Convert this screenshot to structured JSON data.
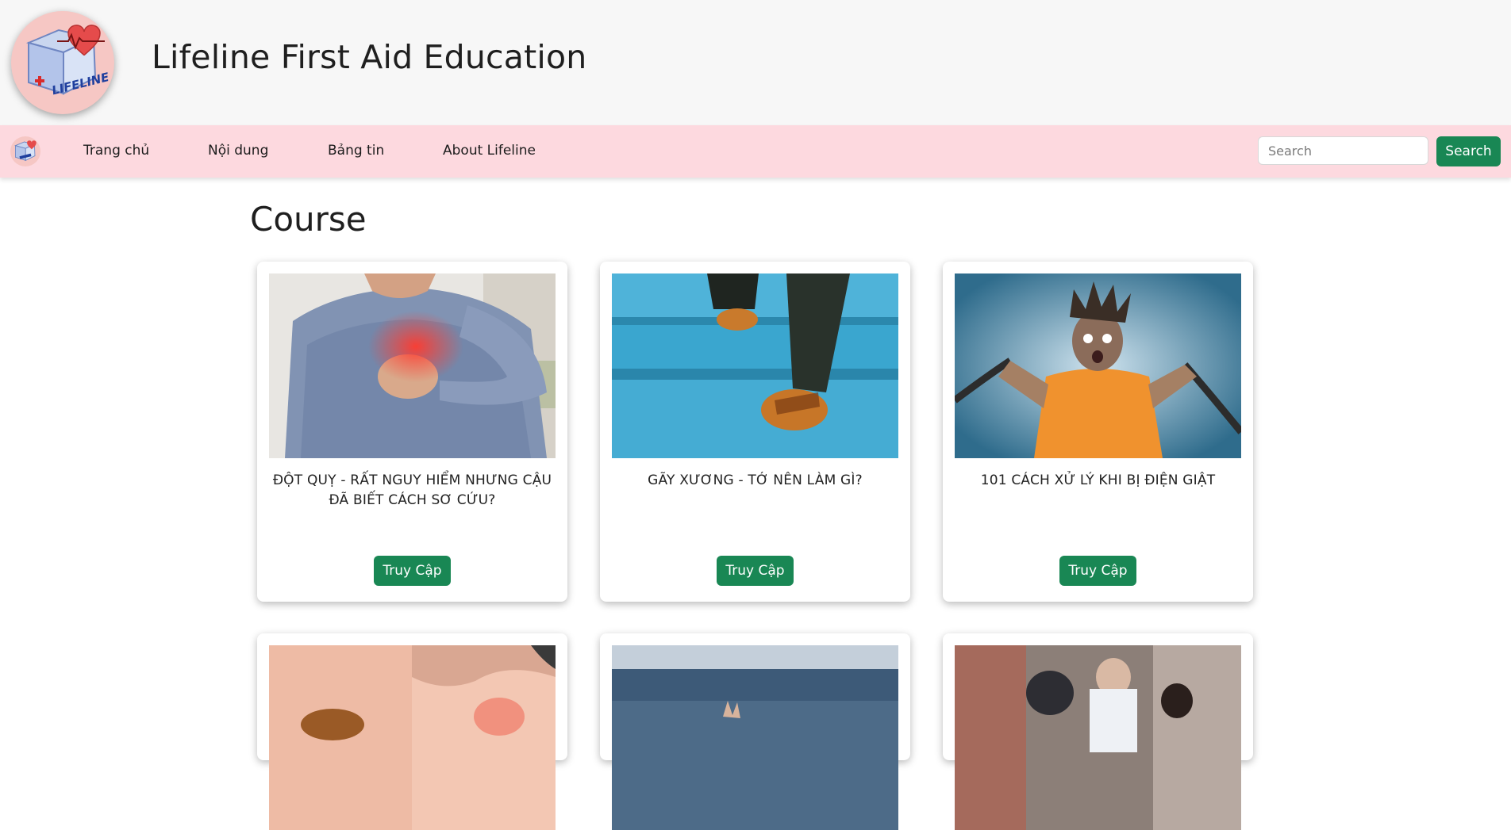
{
  "header": {
    "title": "Lifeline First Aid Education",
    "logo_text": "LIFELINE"
  },
  "nav": {
    "items": [
      {
        "label": "Trang chủ"
      },
      {
        "label": "Nội dung"
      },
      {
        "label": "Bảng tin"
      },
      {
        "label": "About Lifeline"
      }
    ],
    "search": {
      "placeholder": "Search",
      "value": "",
      "button_label": "Search"
    }
  },
  "main": {
    "section_title": "Course",
    "cards": [
      {
        "title": "ĐỘT QUỴ - RẤT NGUY HIỂM NHƯNG CẬU ĐÃ BIẾT CÁCH SƠ CỨU?",
        "button_label": "Truy Cập",
        "image_icon": "chest-pain-photo"
      },
      {
        "title": "GÃY XƯƠNG - TỚ NÊN LÀM GÌ?",
        "button_label": "Truy Cập",
        "image_icon": "stairs-shoes-photo"
      },
      {
        "title": "101 CÁCH XỬ LÝ KHI BỊ ĐIỆN GIẬT",
        "button_label": "Truy Cập",
        "image_icon": "electric-shock-photo"
      },
      {
        "title": "",
        "button_label": "",
        "image_icon": "insect-bite-photo"
      },
      {
        "title": "",
        "button_label": "",
        "image_icon": "drowning-photo"
      },
      {
        "title": "",
        "button_label": "",
        "image_icon": "road-accident-photo"
      }
    ]
  },
  "colors": {
    "header_bg": "#f7f7f7",
    "nav_bg": "#fdd9df",
    "button_green": "#198754",
    "logo_bg": "#f6c7c4"
  }
}
